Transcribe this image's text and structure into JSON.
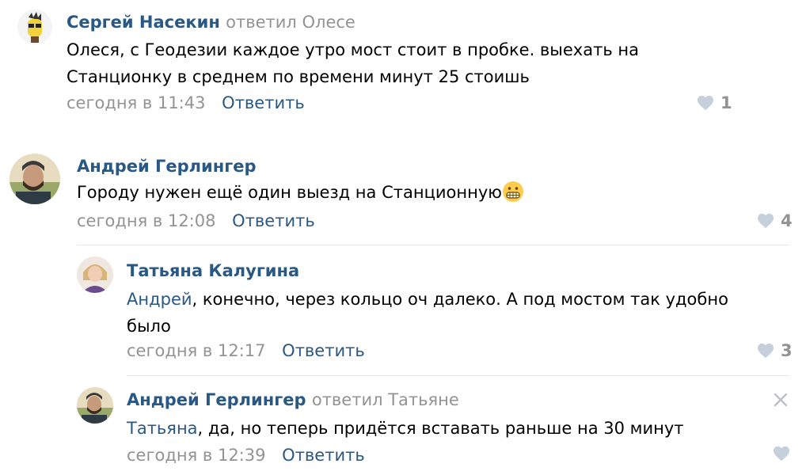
{
  "comments": [
    {
      "author": "Сергей Насекин",
      "replied_to": "ответил Олесе",
      "mention": "",
      "text_line1": "Олеся, с Геодезии каждое утро мост стоит в пробке. выехать на",
      "text_line2": "Станционку в среднем по времени минут 25 стоишь",
      "time": "сегодня в 11:43",
      "reply_label": "Ответить",
      "likes": "1"
    },
    {
      "author": "Андрей Герлингер",
      "replied_to": "",
      "mention": "",
      "text_line1": "Городу нужен ещё один выезд на Станционную",
      "text_line2": "",
      "time": "сегодня в 12:08",
      "reply_label": "Ответить",
      "likes": "4"
    },
    {
      "author": "Татьяна Калугина",
      "replied_to": "",
      "mention": "Андрей",
      "text_line1": ", конечно, через кольцо оч далеко. А под мостом так удобно",
      "text_line2": "было",
      "time": "сегодня в 12:17",
      "reply_label": "Ответить",
      "likes": "3"
    },
    {
      "author": "Андрей Герлингер",
      "replied_to": "ответил Татьяне",
      "mention": "Татьяна",
      "text_line1": ", да, но теперь придётся вставать раньше на 30 минут",
      "text_line2": "",
      "time": "сегодня в 12:39",
      "reply_label": "Ответить",
      "likes": ""
    }
  ],
  "icons": {
    "like": "heart-icon",
    "close": "close-icon",
    "emoji": "grimacing-face-emoji"
  },
  "colors": {
    "link": "#2a5885",
    "muted": "#939393",
    "heart": "#c5d0db",
    "divider": "#e7e8ec"
  }
}
